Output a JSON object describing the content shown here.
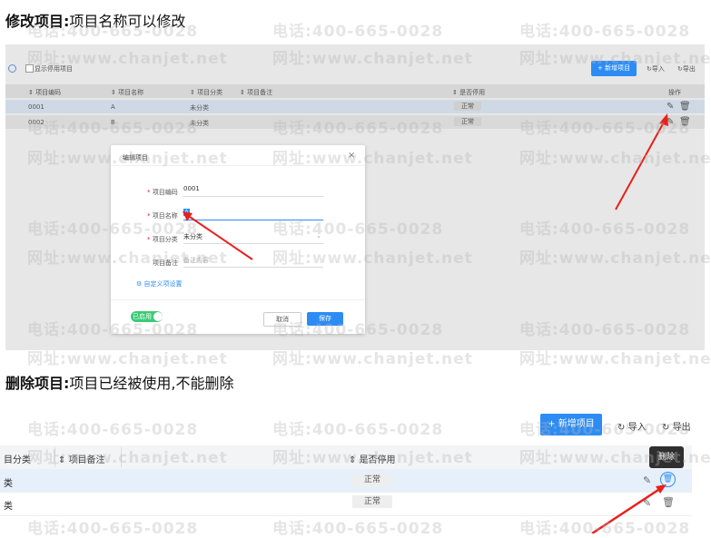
{
  "headings": {
    "edit_label": "修改项目:",
    "edit_desc": "项目名称可以修改",
    "delete_label": "删除项目:",
    "delete_desc": "项目已经被使用,不能删除"
  },
  "watermark": {
    "phone": "电话:400-665-0028",
    "site": "网址:www.chanjet.net"
  },
  "shot1": {
    "show_disabled_label": "显示停用项目",
    "add_button": "+ 新增项目",
    "import_label": "导入",
    "export_label": "导出",
    "columns": [
      "项目编码",
      "项目名称",
      "项目分类",
      "项目备注",
      "是否停用",
      "操作"
    ],
    "rows": [
      {
        "code": "0001",
        "name": "A",
        "category": "未分类",
        "status": "正常"
      },
      {
        "code": "0002",
        "name": "B",
        "category": "未分类",
        "status": "正常"
      }
    ],
    "dialog": {
      "title": "编辑项目",
      "code_label": "项目编码",
      "code_value": "0001",
      "name_label": "项目名称",
      "name_value": "A",
      "category_label": "项目分类",
      "category_value": "未分类",
      "remark_label": "项目备注",
      "remark_placeholder": "备注内容",
      "custom_link": "自定义项设置",
      "toggle_label": "已启用",
      "cancel": "取消",
      "save": "保存"
    }
  },
  "shot2": {
    "add_button": "+ 新增项目",
    "import_label": "导入",
    "export_label": "导出",
    "col_category": "目分类",
    "col_remark": "项目备注",
    "col_status": "是否停用",
    "tooltip": "删除",
    "rows": [
      {
        "category": "类",
        "status": "正常"
      },
      {
        "category": "类",
        "status": "正常"
      }
    ]
  },
  "colors": {
    "accent": "#2c8cf4",
    "arrow": "#e8201c",
    "toggle": "#3ccb76"
  }
}
